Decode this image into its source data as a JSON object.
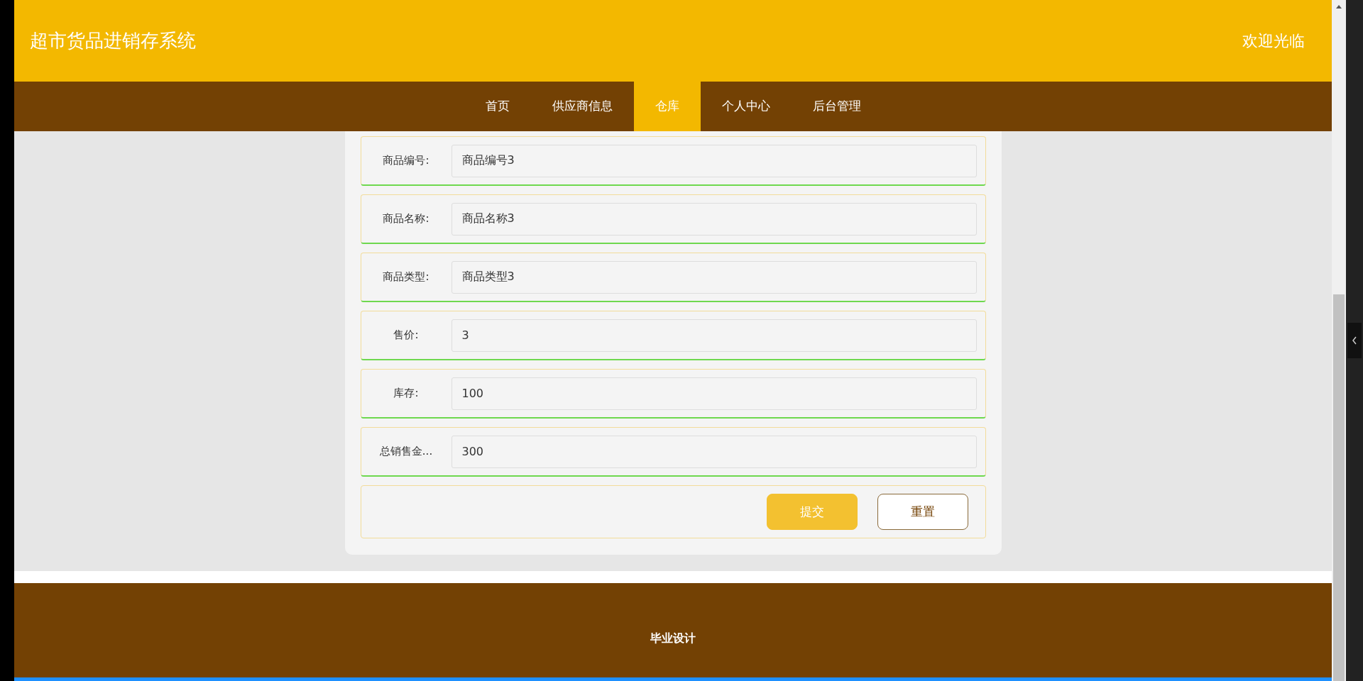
{
  "header": {
    "title": "超市货品进销存系统",
    "welcome": "欢迎光临"
  },
  "nav": [
    {
      "label": "首页",
      "selected": false
    },
    {
      "label": "供应商信息",
      "selected": false
    },
    {
      "label": "仓库",
      "selected": true
    },
    {
      "label": "个人中心",
      "selected": false
    },
    {
      "label": "后台管理",
      "selected": false
    }
  ],
  "form": {
    "fields": [
      {
        "label": "商品编号:",
        "value": "商品编号3"
      },
      {
        "label": "商品名称:",
        "value": "商品名称3"
      },
      {
        "label": "商品类型:",
        "value": "商品类型3"
      },
      {
        "label": "售价:",
        "value": "3"
      },
      {
        "label": "库存:",
        "value": "100"
      },
      {
        "label": "总销售金...",
        "value": "300"
      }
    ],
    "buttons": [
      {
        "label": "提交",
        "kind": "primary"
      },
      {
        "label": "重置",
        "kind": "outline"
      }
    ]
  },
  "footer": {
    "text": "毕业设计"
  }
}
